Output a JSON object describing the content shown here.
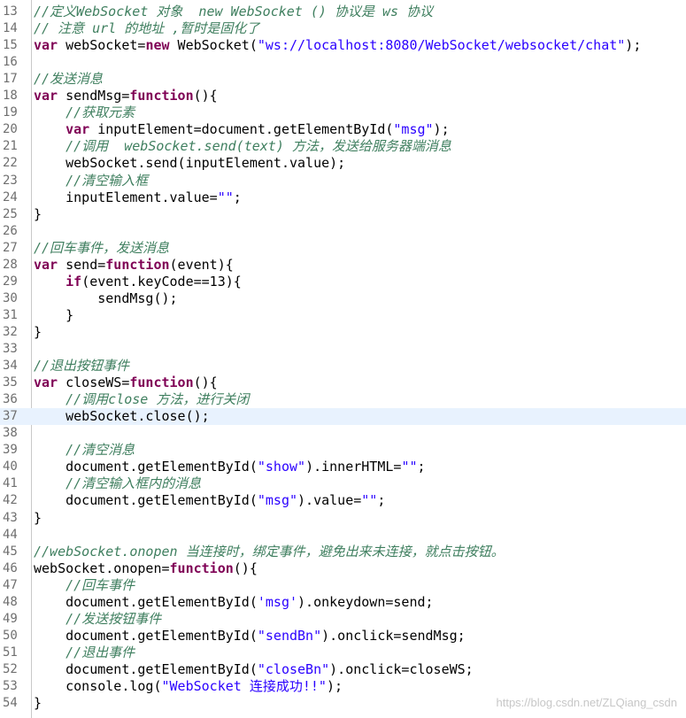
{
  "editor": {
    "lines": [
      {
        "n": "13",
        "tokens": [
          [
            "cm",
            "//定义WebSocket 对象  new WebSocket () 协议是 ws 协议"
          ]
        ]
      },
      {
        "n": "14",
        "tokens": [
          [
            "cm",
            "// 注意 url 的地址 ,暂时是固化了"
          ]
        ]
      },
      {
        "n": "15",
        "tokens": [
          [
            "kw",
            "var"
          ],
          [
            "pl",
            " webSocket="
          ],
          [
            "kw",
            "new"
          ],
          [
            "pl",
            " WebSocket("
          ],
          [
            "str",
            "\"ws://localhost:8080/WebSocket/websocket/chat\""
          ],
          [
            "pl",
            ");"
          ]
        ]
      },
      {
        "n": "16",
        "tokens": []
      },
      {
        "n": "17",
        "tokens": [
          [
            "cm",
            "//发送消息"
          ]
        ]
      },
      {
        "n": "18",
        "tokens": [
          [
            "kw",
            "var"
          ],
          [
            "pl",
            " sendMsg="
          ],
          [
            "kw",
            "function"
          ],
          [
            "pl",
            "(){"
          ]
        ]
      },
      {
        "n": "19",
        "tokens": [
          [
            "pl",
            "    "
          ],
          [
            "cm",
            "//获取元素"
          ]
        ]
      },
      {
        "n": "20",
        "tokens": [
          [
            "pl",
            "    "
          ],
          [
            "kw",
            "var"
          ],
          [
            "pl",
            " inputElement=document.getElementById("
          ],
          [
            "str",
            "\"msg\""
          ],
          [
            "pl",
            ");"
          ]
        ]
      },
      {
        "n": "21",
        "tokens": [
          [
            "pl",
            "    "
          ],
          [
            "cm",
            "//调用  webSocket.send(text) 方法，发送给服务器端消息"
          ]
        ]
      },
      {
        "n": "22",
        "tokens": [
          [
            "pl",
            "    webSocket.send(inputElement.value);"
          ]
        ]
      },
      {
        "n": "23",
        "tokens": [
          [
            "pl",
            "    "
          ],
          [
            "cm",
            "//清空输入框"
          ]
        ]
      },
      {
        "n": "24",
        "tokens": [
          [
            "pl",
            "    inputElement.value="
          ],
          [
            "str",
            "\"\""
          ],
          [
            "pl",
            ";"
          ]
        ]
      },
      {
        "n": "25",
        "tokens": [
          [
            "pl",
            "}"
          ]
        ]
      },
      {
        "n": "26",
        "tokens": []
      },
      {
        "n": "27",
        "tokens": [
          [
            "cm",
            "//回车事件，发送消息"
          ]
        ]
      },
      {
        "n": "28",
        "tokens": [
          [
            "kw",
            "var"
          ],
          [
            "pl",
            " send="
          ],
          [
            "kw",
            "function"
          ],
          [
            "pl",
            "(event){"
          ]
        ]
      },
      {
        "n": "29",
        "tokens": [
          [
            "pl",
            "    "
          ],
          [
            "kw",
            "if"
          ],
          [
            "pl",
            "(event.keyCode==13){"
          ]
        ]
      },
      {
        "n": "30",
        "tokens": [
          [
            "pl",
            "        sendMsg();"
          ]
        ]
      },
      {
        "n": "31",
        "tokens": [
          [
            "pl",
            "    }"
          ]
        ]
      },
      {
        "n": "32",
        "tokens": [
          [
            "pl",
            "}"
          ]
        ]
      },
      {
        "n": "33",
        "tokens": []
      },
      {
        "n": "34",
        "tokens": [
          [
            "cm",
            "//退出按钮事件"
          ]
        ]
      },
      {
        "n": "35",
        "tokens": [
          [
            "kw",
            "var"
          ],
          [
            "pl",
            " closeWS="
          ],
          [
            "kw",
            "function"
          ],
          [
            "pl",
            "(){"
          ]
        ]
      },
      {
        "n": "36",
        "tokens": [
          [
            "pl",
            "    "
          ],
          [
            "cm",
            "//调用close 方法，进行关闭"
          ]
        ]
      },
      {
        "n": "37",
        "tokens": [
          [
            "pl",
            "    webSocket.close();"
          ]
        ],
        "current": true
      },
      {
        "n": "38",
        "tokens": []
      },
      {
        "n": "39",
        "tokens": [
          [
            "pl",
            "    "
          ],
          [
            "cm",
            "//清空消息"
          ]
        ]
      },
      {
        "n": "40",
        "tokens": [
          [
            "pl",
            "    document.getElementById("
          ],
          [
            "str",
            "\"show\""
          ],
          [
            "pl",
            ").innerHTML="
          ],
          [
            "str",
            "\"\""
          ],
          [
            "pl",
            ";"
          ]
        ]
      },
      {
        "n": "41",
        "tokens": [
          [
            "pl",
            "    "
          ],
          [
            "cm",
            "//清空输入框内的消息"
          ]
        ]
      },
      {
        "n": "42",
        "tokens": [
          [
            "pl",
            "    document.getElementById("
          ],
          [
            "str",
            "\"msg\""
          ],
          [
            "pl",
            ").value="
          ],
          [
            "str",
            "\"\""
          ],
          [
            "pl",
            ";"
          ]
        ]
      },
      {
        "n": "43",
        "tokens": [
          [
            "pl",
            "}"
          ]
        ]
      },
      {
        "n": "44",
        "tokens": []
      },
      {
        "n": "45",
        "tokens": [
          [
            "cm",
            "//webSocket.onopen 当连接时，绑定事件，避免出来未连接，就点击按钮。"
          ]
        ]
      },
      {
        "n": "46",
        "tokens": [
          [
            "pl",
            "webSocket.onopen="
          ],
          [
            "kw",
            "function"
          ],
          [
            "pl",
            "(){"
          ]
        ]
      },
      {
        "n": "47",
        "tokens": [
          [
            "pl",
            "    "
          ],
          [
            "cm",
            "//回车事件"
          ]
        ]
      },
      {
        "n": "48",
        "tokens": [
          [
            "pl",
            "    document.getElementById("
          ],
          [
            "str",
            "'msg'"
          ],
          [
            "pl",
            ").onkeydown=send;"
          ]
        ]
      },
      {
        "n": "49",
        "tokens": [
          [
            "pl",
            "    "
          ],
          [
            "cm",
            "//发送按钮事件"
          ]
        ]
      },
      {
        "n": "50",
        "tokens": [
          [
            "pl",
            "    document.getElementById("
          ],
          [
            "str",
            "\"sendBn\""
          ],
          [
            "pl",
            ").onclick=sendMsg;"
          ]
        ]
      },
      {
        "n": "51",
        "tokens": [
          [
            "pl",
            "    "
          ],
          [
            "cm",
            "//退出事件"
          ]
        ]
      },
      {
        "n": "52",
        "tokens": [
          [
            "pl",
            "    document.getElementById("
          ],
          [
            "str",
            "\"closeBn\""
          ],
          [
            "pl",
            ").onclick=closeWS;"
          ]
        ]
      },
      {
        "n": "53",
        "tokens": [
          [
            "pl",
            "    console.log("
          ],
          [
            "str",
            "\"WebSocket 连接成功!!\""
          ],
          [
            "pl",
            ");"
          ]
        ]
      },
      {
        "n": "54",
        "tokens": [
          [
            "pl",
            "}"
          ]
        ]
      }
    ]
  },
  "watermark": "https://blog.csdn.net/ZLQiang_csdn",
  "colors": {
    "keyword": "#7f0055",
    "string": "#2a00ff",
    "comment": "#3f7f5f",
    "current_line": "#e8f2fe",
    "line_number": "#6f6f6f"
  }
}
